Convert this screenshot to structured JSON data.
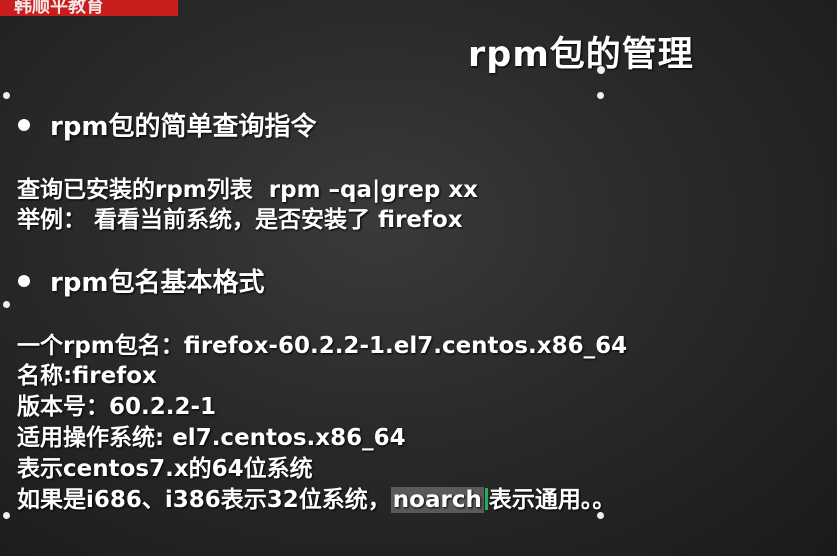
{
  "header_tag": "韩顺平教育",
  "slide": {
    "title": "rpm包的管理",
    "section1": {
      "heading": "rpm包的简单查询指令",
      "line1_label": "查询已安装的rpm列表",
      "line1_command": "rpm –qa|grep xx",
      "line2": "举例： 看看当前系统，是否安装了 firefox"
    },
    "section2": {
      "heading": "rpm包名基本格式",
      "lines": [
        "一个rpm包名：firefox-60.2.2-1.el7.centos.x86_64",
        "名称:firefox",
        "版本号：60.2.2-1",
        "适用操作系统: el7.centos.x86_64",
        "表示centos7.x的64位系统"
      ],
      "last_line_prefix": "如果是i686、i386表示32位系统，",
      "last_line_highlight": "noarch",
      "last_line_suffix": "表示通用。。"
    }
  },
  "colors": {
    "background": "#2a2a2a",
    "tag": "#c81e1e",
    "text": "#ffffff",
    "highlight": "#5a5a5a",
    "cursor": "#1fae5c"
  }
}
